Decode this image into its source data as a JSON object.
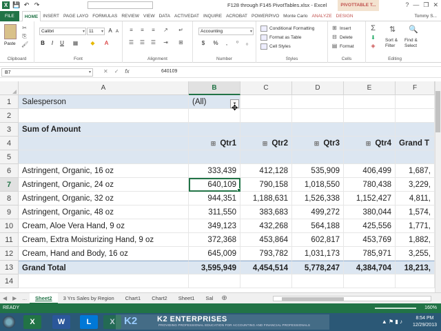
{
  "titlebar": {
    "document_title": "F128 through F145 PivotTables.xlsx - Excel",
    "pivot_tools_label": "PIVOTTABLE T...",
    "window_buttons": [
      "?",
      "—",
      "❐",
      "✕"
    ]
  },
  "ribbon_tabs": {
    "file": "FILE",
    "items": [
      "HOME",
      "INSERT",
      "PAGE LAYO",
      "FORMULAS",
      "REVIEW",
      "VIEW",
      "DATA",
      "ACTIVEDAT",
      "INQUIRE",
      "ACROBAT",
      "POWERPIVO",
      "Monte Carlo",
      "ANALYZE",
      "DESIGN"
    ],
    "active": "HOME",
    "user": "Tommy S..."
  },
  "ribbon": {
    "clipboard": {
      "label": "Clipboard",
      "paste": "Paste"
    },
    "font": {
      "label": "Font",
      "font_name": "Calibri",
      "font_size": "11",
      "bold": "B",
      "italic": "I",
      "underline": "U",
      "grow": "A",
      "shrink": "A"
    },
    "alignment": {
      "label": "Alignment"
    },
    "number": {
      "label": "Number",
      "format": "Accounting",
      "currency": "$",
      "percent": "%",
      "comma": ","
    },
    "styles": {
      "label": "Styles",
      "conditional": "Conditional Formatting",
      "format_table": "Format as Table",
      "cell_styles": "Cell Styles"
    },
    "cells": {
      "label": "Cells",
      "insert": "Insert",
      "delete": "Delete",
      "format": "Format"
    },
    "editing": {
      "label": "Editing",
      "sort": "Sort &",
      "filter": "Filter",
      "find": "Find &",
      "select": "Select"
    }
  },
  "formula_bar": {
    "name_box": "B7",
    "cancel": "✕",
    "enter": "✓",
    "fx": "fx",
    "value": "640109"
  },
  "grid": {
    "columns": [
      "A",
      "B",
      "C",
      "D",
      "E",
      "F"
    ],
    "selected_column": "B",
    "selected_row": "7",
    "rows": [
      {
        "num": "1",
        "a": "Salesperson",
        "b": "(All)",
        "c": "",
        "d": "",
        "e": "",
        "f": ""
      },
      {
        "num": "2",
        "a": "",
        "b": "",
        "c": "",
        "d": "",
        "e": "",
        "f": ""
      },
      {
        "num": "3",
        "a": "Sum of Amount",
        "b": "",
        "c": "",
        "d": "",
        "e": "",
        "f": ""
      },
      {
        "num": "4",
        "a": "",
        "b": "Qtr1",
        "c": "Qtr2",
        "d": "Qtr3",
        "e": "Qtr4",
        "f": "Grand T"
      },
      {
        "num": "5",
        "a": "",
        "b": "",
        "c": "",
        "d": "",
        "e": "",
        "f": ""
      },
      {
        "num": "6",
        "a": "Astringent, Organic, 16 oz",
        "b": "333,439",
        "c": "412,128",
        "d": "535,909",
        "e": "406,499",
        "f": "1,687,"
      },
      {
        "num": "7",
        "a": "Astringent, Organic, 24 oz",
        "b": "640,109",
        "c": "790,158",
        "d": "1,018,550",
        "e": "780,438",
        "f": "3,229,"
      },
      {
        "num": "8",
        "a": "Astringent, Organic, 32 oz",
        "b": "944,351",
        "c": "1,188,631",
        "d": "1,526,338",
        "e": "1,152,427",
        "f": "4,811,"
      },
      {
        "num": "9",
        "a": "Astringent, Organic, 48 oz",
        "b": "311,550",
        "c": "383,683",
        "d": "499,272",
        "e": "380,044",
        "f": "1,574,"
      },
      {
        "num": "10",
        "a": "Cream, Aloe Vera Hand, 9 oz",
        "b": "349,123",
        "c": "432,268",
        "d": "564,188",
        "e": "425,556",
        "f": "1,771,"
      },
      {
        "num": "11",
        "a": "Cream, Extra Moisturizing Hand, 9 oz",
        "b": "372,368",
        "c": "453,864",
        "d": "602,817",
        "e": "453,769",
        "f": "1,882,"
      },
      {
        "num": "12",
        "a": "Cream, Hand and Body, 16 oz",
        "b": "645,009",
        "c": "793,782",
        "d": "1,031,173",
        "e": "785,971",
        "f": "3,255,"
      },
      {
        "num": "13",
        "a": "Grand Total",
        "b": "3,595,949",
        "c": "4,454,514",
        "d": "5,778,247",
        "e": "4,384,704",
        "f": "18,213,"
      },
      {
        "num": "14",
        "a": "",
        "b": "",
        "c": "",
        "d": "",
        "e": "",
        "f": ""
      }
    ]
  },
  "sheet_tabs": {
    "items": [
      "Sheet2",
      "3 Yrs Sales by Region",
      "Chart1",
      "Chart2",
      "Sheet1",
      "Sal"
    ],
    "active": "Sheet2",
    "more": "..."
  },
  "statusbar": {
    "status": "READY",
    "zoom": "160%"
  },
  "taskbar": {
    "apps": [
      "X",
      "W",
      "L",
      "X"
    ],
    "k2_logo": "K2",
    "k2_name": "K2 ENTERPRISES",
    "k2_tagline": "PROVIDING PROFESSIONAL EDUCATION FOR ACCOUNTING AND FINANCIAL PROFESSIONALS",
    "time": "8:54 PM",
    "date": "12/29/2013"
  },
  "colors": {
    "excel_green": "#217346",
    "pivot_band": "#dce6f1",
    "analyze_red": "#c0504d"
  }
}
